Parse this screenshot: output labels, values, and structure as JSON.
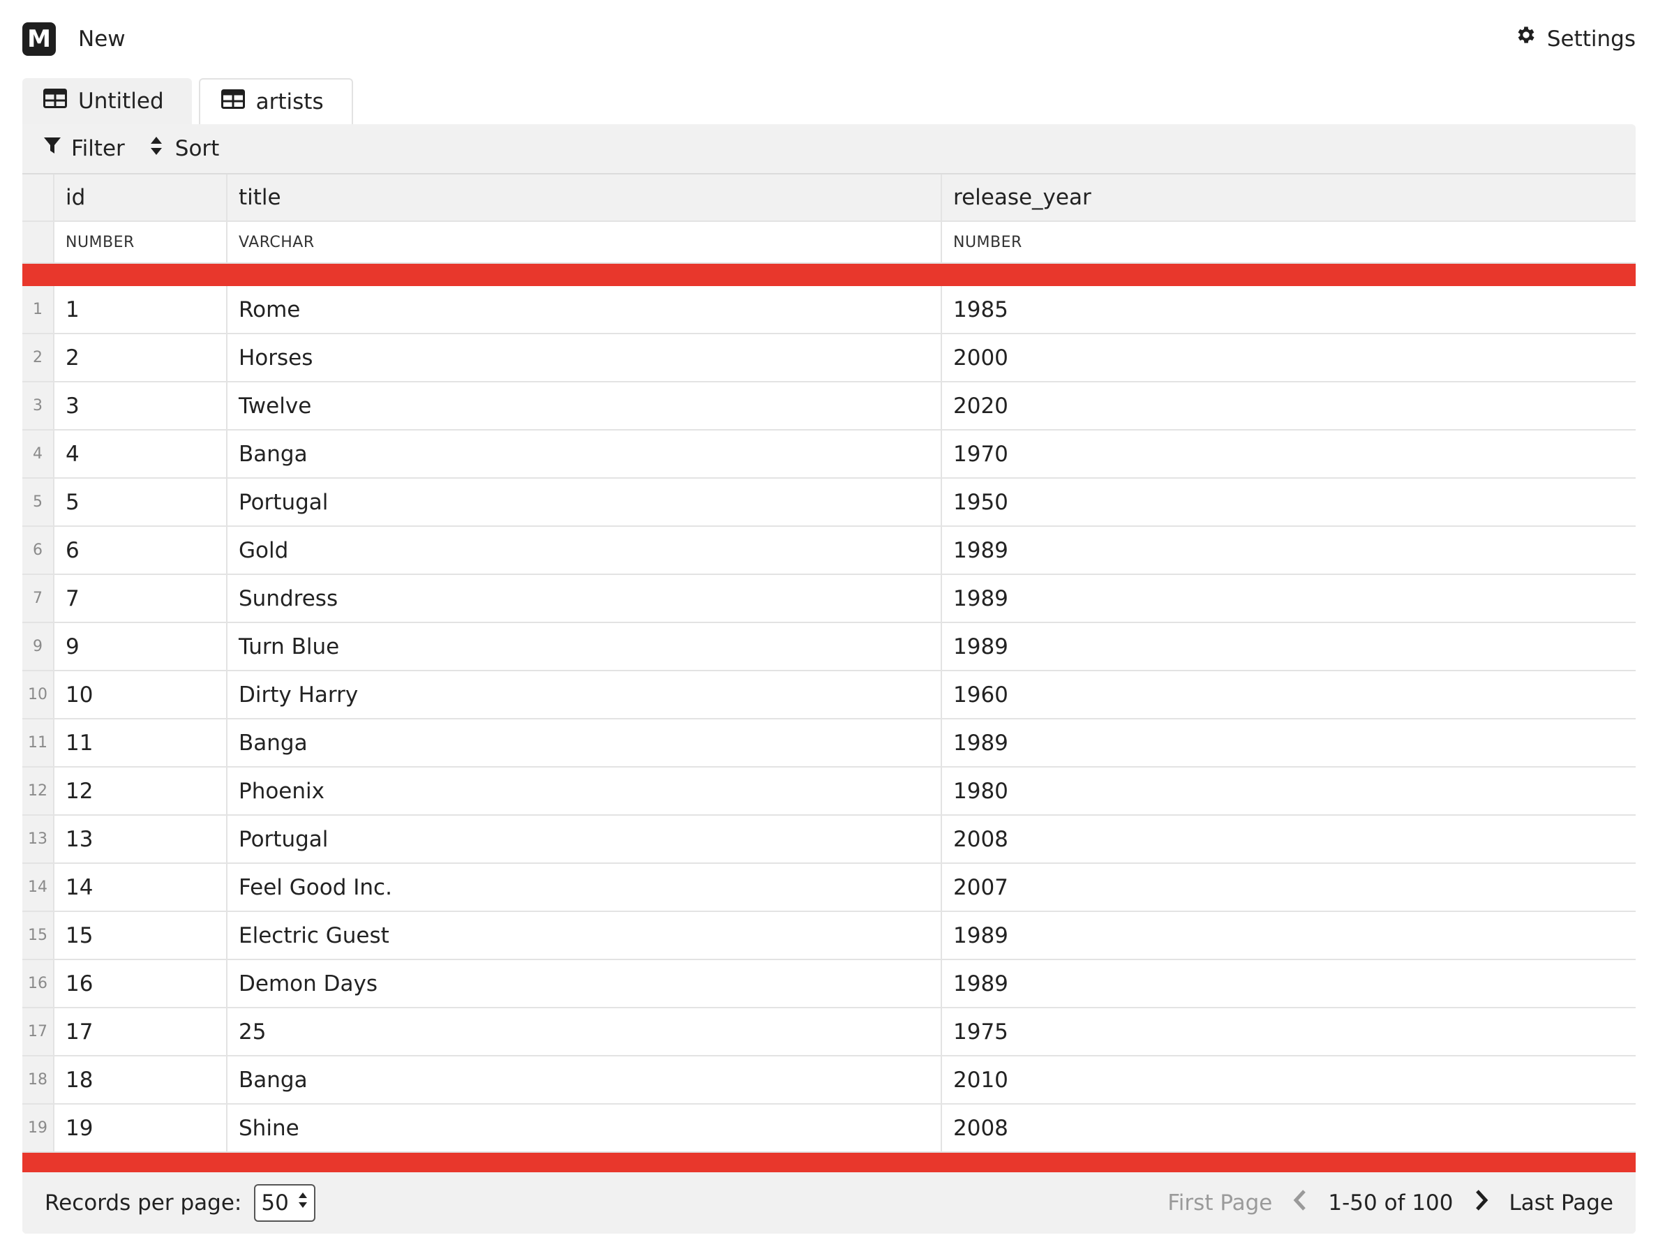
{
  "topbar": {
    "logo_letter": "M",
    "new_label": "New",
    "settings_label": "Settings"
  },
  "tabs": [
    {
      "label": "Untitled",
      "icon": "table-icon",
      "active": true
    },
    {
      "label": "artists",
      "icon": "table-icon",
      "active": false
    }
  ],
  "toolbar": {
    "filter_label": "Filter",
    "sort_label": "Sort"
  },
  "grid": {
    "columns": [
      {
        "name": "id",
        "type": "NUMBER"
      },
      {
        "name": "title",
        "type": "VARCHAR"
      },
      {
        "name": "release_year",
        "type": "NUMBER"
      }
    ],
    "rows": [
      {
        "num": "1",
        "id": "1",
        "title": "Rome",
        "release_year": "1985"
      },
      {
        "num": "2",
        "id": "2",
        "title": "Horses",
        "release_year": "2000"
      },
      {
        "num": "3",
        "id": "3",
        "title": "Twelve",
        "release_year": "2020"
      },
      {
        "num": "4",
        "id": "4",
        "title": "Banga",
        "release_year": "1970"
      },
      {
        "num": "5",
        "id": "5",
        "title": "Portugal",
        "release_year": "1950"
      },
      {
        "num": "6",
        "id": "6",
        "title": "Gold",
        "release_year": "1989"
      },
      {
        "num": "7",
        "id": "7",
        "title": "Sundress",
        "release_year": "1989"
      },
      {
        "num": "9",
        "id": "9",
        "title": "Turn Blue",
        "release_year": "1989"
      },
      {
        "num": "10",
        "id": "10",
        "title": "Dirty Harry",
        "release_year": "1960"
      },
      {
        "num": "11",
        "id": "11",
        "title": "Banga",
        "release_year": "1989"
      },
      {
        "num": "12",
        "id": "12",
        "title": "Phoenix",
        "release_year": "1980"
      },
      {
        "num": "13",
        "id": "13",
        "title": "Portugal",
        "release_year": "2008"
      },
      {
        "num": "14",
        "id": "14",
        "title": "Feel Good Inc.",
        "release_year": "2007"
      },
      {
        "num": "15",
        "id": "15",
        "title": "Electric Guest",
        "release_year": "1989"
      },
      {
        "num": "16",
        "id": "16",
        "title": "Demon Days",
        "release_year": "1989"
      },
      {
        "num": "17",
        "id": "17",
        "title": "25",
        "release_year": "1975"
      },
      {
        "num": "18",
        "id": "18",
        "title": "Banga",
        "release_year": "2010"
      },
      {
        "num": "19",
        "id": "19",
        "title": "Shine",
        "release_year": "2008"
      }
    ]
  },
  "footer": {
    "records_per_page_label": "Records per page:",
    "records_per_page_value": "50",
    "first_page_label": "First Page",
    "range_label": "1-50 of 100",
    "last_page_label": "Last Page"
  },
  "colors": {
    "accent_bar": "#e8372c",
    "panel_bg": "#f1f1f1"
  }
}
